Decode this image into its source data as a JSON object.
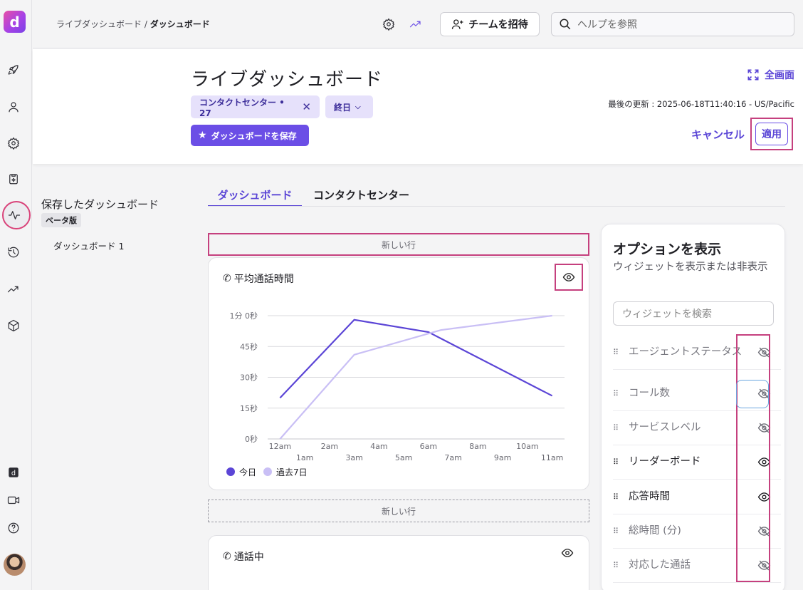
{
  "rail": {
    "icons": [
      "rocket-icon",
      "person-icon",
      "gear-icon",
      "clipboard-sparkle-icon",
      "activity-icon",
      "history-icon",
      "trend-icon",
      "cube-icon",
      "app-logo-small-icon",
      "video-icon",
      "help-icon"
    ]
  },
  "logo": "d",
  "topbar": {
    "breadcrumb_parent": "ライブダッシュボード",
    "breadcrumb_sep": " / ",
    "breadcrumb_current": "ダッシュボード",
    "invite_label": "チームを招待",
    "help_placeholder": "ヘルプを参照"
  },
  "header": {
    "title": "ライブダッシュボード",
    "chip_contact": "コンタクトセンター • 27",
    "chip_range": "終日",
    "save_label": "ダッシュボードを保存",
    "fullscreen_label": "全画面",
    "updated": "最後の更新 : 2025-06-18T11:40:16 - US/Pacific",
    "cancel_label": "キャンセル",
    "apply_label": "適用"
  },
  "saved": {
    "title": "保存したダッシュボード",
    "badge": "ベータ版",
    "items": [
      "ダッシュボード 1"
    ]
  },
  "tabs": [
    {
      "label": "ダッシュボード",
      "active": true
    },
    {
      "label": "コンタクトセンター",
      "active": false
    }
  ],
  "new_row_label": "新しい行",
  "widgets": [
    {
      "title": "平均通話時間"
    },
    {
      "title": "通話中"
    }
  ],
  "chart_data": {
    "type": "line",
    "y_ticks": [
      "0秒",
      "15秒",
      "30秒",
      "45秒",
      "1分 0秒"
    ],
    "x_ticks_top": [
      "12am",
      "2am",
      "4am",
      "6am",
      "8am",
      "10am"
    ],
    "x_ticks_bottom": [
      "1am",
      "3am",
      "5am",
      "7am",
      "9am",
      "11am"
    ],
    "ylim": [
      0,
      60
    ],
    "series": [
      {
        "name": "今日",
        "color": "#5b45d6",
        "points": [
          [
            0.5,
            20
          ],
          [
            3.5,
            58
          ],
          [
            6.5,
            52
          ],
          [
            11.5,
            21
          ]
        ]
      },
      {
        "name": "過去7日",
        "color": "#c9bff5",
        "points": [
          [
            0.5,
            0
          ],
          [
            3.5,
            41
          ],
          [
            7.0,
            53
          ],
          [
            11.5,
            60
          ]
        ]
      }
    ]
  },
  "options": {
    "title": "オプションを表示",
    "subtitle": "ウィジェットを表示または非表示",
    "search_placeholder": "ウィジェットを検索",
    "items": [
      {
        "label": "エージェントステータス",
        "visible": false
      },
      {
        "label": "コール数",
        "visible": false
      },
      {
        "label": "サービスレベル",
        "visible": false
      },
      {
        "label": "リーダーボード",
        "visible": true
      },
      {
        "label": "応答時間",
        "visible": true
      },
      {
        "label": "総時間 (分)",
        "visible": false
      },
      {
        "label": "対応した通話",
        "visible": false
      }
    ]
  }
}
